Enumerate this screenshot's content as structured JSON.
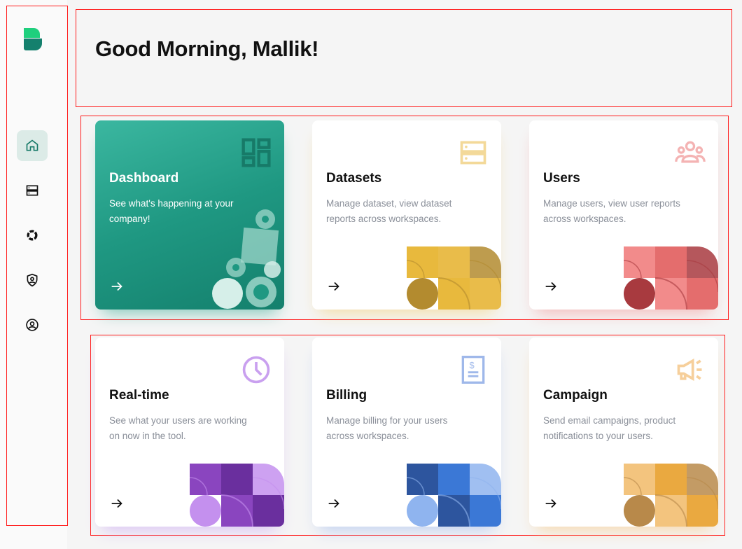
{
  "greeting": "Good Morning, Mallik!",
  "sidebar": {
    "items": [
      {
        "name": "home",
        "icon": "home-icon",
        "active": true
      },
      {
        "name": "datasets",
        "icon": "server-icon",
        "active": false
      },
      {
        "name": "realtime",
        "icon": "loader-icon",
        "active": false
      },
      {
        "name": "security",
        "icon": "shield-user-icon",
        "active": false
      },
      {
        "name": "profile",
        "icon": "user-circle-icon",
        "active": false
      }
    ]
  },
  "cards": [
    {
      "title": "Dashboard",
      "desc": "See what's happening at your company!",
      "icon": "dashboard-grid-icon",
      "accent": "#177a68",
      "colors": [
        "#d6efe9",
        "#a8dbd0",
        "#c5e8e0"
      ],
      "shadow": "#7cc5b6"
    },
    {
      "title": "Datasets",
      "desc": "Manage dataset, view dataset reports across workspaces.",
      "icon": "server-icon",
      "accent": "#f3d999",
      "colors": [
        "#e8b93d",
        "#b38b2f",
        "#e9bc4a"
      ],
      "shadow": "#f3dca0"
    },
    {
      "title": "Users",
      "desc": "Manage users, view user reports across workspaces.",
      "icon": "users-icon",
      "accent": "#f4b3b3",
      "colors": [
        "#f28b8b",
        "#a83a3f",
        "#e46d6d"
      ],
      "shadow": "#f4b5b5"
    },
    {
      "title": "Real-time",
      "desc": "See what your users are working on now in the tool.",
      "icon": "clock-icon",
      "accent": "#c9a0ef",
      "colors": [
        "#8a45bf",
        "#c490ee",
        "#6a2f9e"
      ],
      "shadow": "#d8bff4"
    },
    {
      "title": "Billing",
      "desc": "Manage billing for your users across workspaces.",
      "icon": "invoice-icon",
      "accent": "#9fb8ea",
      "colors": [
        "#2d559e",
        "#8fb4ef",
        "#3b78d6"
      ],
      "shadow": "#bccdf0"
    },
    {
      "title": "Campaign",
      "desc": "Send email campaigns, product notifications to your users.",
      "icon": "megaphone-icon",
      "accent": "#f6cf9b",
      "colors": [
        "#f3c47e",
        "#b8894a",
        "#eaa940"
      ],
      "shadow": "#f6d6a8"
    }
  ]
}
